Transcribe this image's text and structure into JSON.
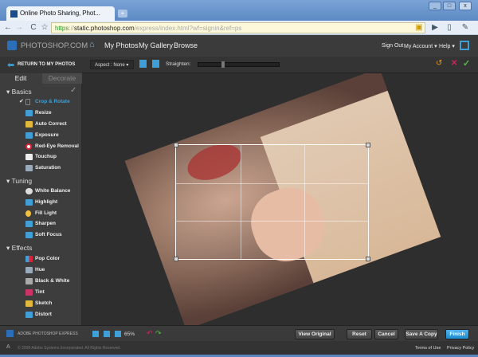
{
  "browser": {
    "tab_title": "Online Photo Sharing, Phot...",
    "url_scheme": "https",
    "url_host": "static.photoshop.com",
    "url_path": "/express/index.html?wf=signin&ref=ps"
  },
  "header": {
    "logo": "PHOTOSHOP.COM",
    "nav": [
      "My Photos",
      "My Gallery",
      "Browse"
    ],
    "sign_out": "Sign Out",
    "my_account": "My Account",
    "help": "Help"
  },
  "toolbar": {
    "return": "RETURN TO MY PHOTOS",
    "aspect": "Aspect : None",
    "straighten": "Straighten:",
    "straighten_value": 0.3
  },
  "tabs": {
    "edit": "Edit",
    "decorate": "Decorate"
  },
  "sections": [
    {
      "title": "Basics",
      "items": [
        "Crop & Rotate",
        "Resize",
        "Auto Correct",
        "Exposure",
        "Red-Eye Removal",
        "Touchup",
        "Saturation"
      ]
    },
    {
      "title": "Tuning",
      "items": [
        "White Balance",
        "Highlight",
        "Fill Light",
        "Sharpen",
        "Soft Focus"
      ]
    },
    {
      "title": "Effects",
      "items": [
        "Pop Color",
        "Hue",
        "Black & White",
        "Tint",
        "Sketch",
        "Distort"
      ]
    }
  ],
  "bottom": {
    "brand": "ADOBE PHOTOSHOP EXPRESS",
    "zoom": "65%",
    "view_original": "View Original",
    "reset": "Reset",
    "cancel": "Cancel",
    "save_copy": "Save A Copy",
    "finish": "Finish"
  },
  "footer": {
    "copyright": "© 2008 Adobe Systems Incorporated. All Rights Reserved.",
    "terms": "Terms of Use",
    "privacy": "Privacy Policy"
  }
}
